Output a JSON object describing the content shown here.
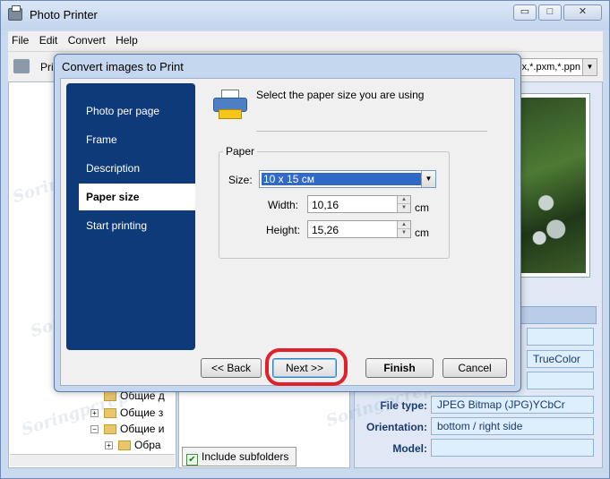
{
  "app": {
    "title": "Photo Printer",
    "window_buttons": {
      "min": "▭",
      "max": "□",
      "close": "✕"
    }
  },
  "menu": [
    {
      "label": "File"
    },
    {
      "label": "Edit"
    },
    {
      "label": "Convert"
    },
    {
      "label": "Help"
    }
  ],
  "toolbar": {
    "label": "Pri",
    "filter_text": "x,*.pxm,*.ppn"
  },
  "tree": [
    {
      "expander": "+",
      "label": "Общие д"
    },
    {
      "expander": "+",
      "label": "Общие з"
    },
    {
      "expander": "−",
      "label": "Общие и"
    },
    {
      "expander": "+",
      "label": "Обра"
    }
  ],
  "include_subfolders": {
    "label": "Include subfolders",
    "checked": true
  },
  "info": {
    "color_value": "TrueColor",
    "file_type_label": "File type:",
    "file_type_value": "JPEG Bitmap (JPG)YCbCr",
    "orientation_label": "Orientation:",
    "orientation_value": "bottom / right side",
    "model_label": "Model:",
    "model_value": ""
  },
  "watermark": "Soringpcrepair.com",
  "dialog": {
    "title": "Convert images to Print",
    "steps": [
      {
        "label": "Photo per page",
        "active": false
      },
      {
        "label": "Frame",
        "active": false
      },
      {
        "label": "Description",
        "active": false
      },
      {
        "label": "Paper size",
        "active": true
      },
      {
        "label": "Start printing",
        "active": false
      }
    ],
    "header": "Select the paper size you are using",
    "paper": {
      "group_label": "Paper",
      "size_label": "Size:",
      "size_value": "10 x 15 см",
      "width_label": "Width:",
      "width_value": "10,16",
      "width_unit": "cm",
      "height_label": "Height:",
      "height_value": "15,26",
      "height_unit": "cm"
    },
    "buttons": {
      "back": "<< Back",
      "next": "Next >>",
      "finish": "Finish",
      "cancel": "Cancel"
    }
  }
}
